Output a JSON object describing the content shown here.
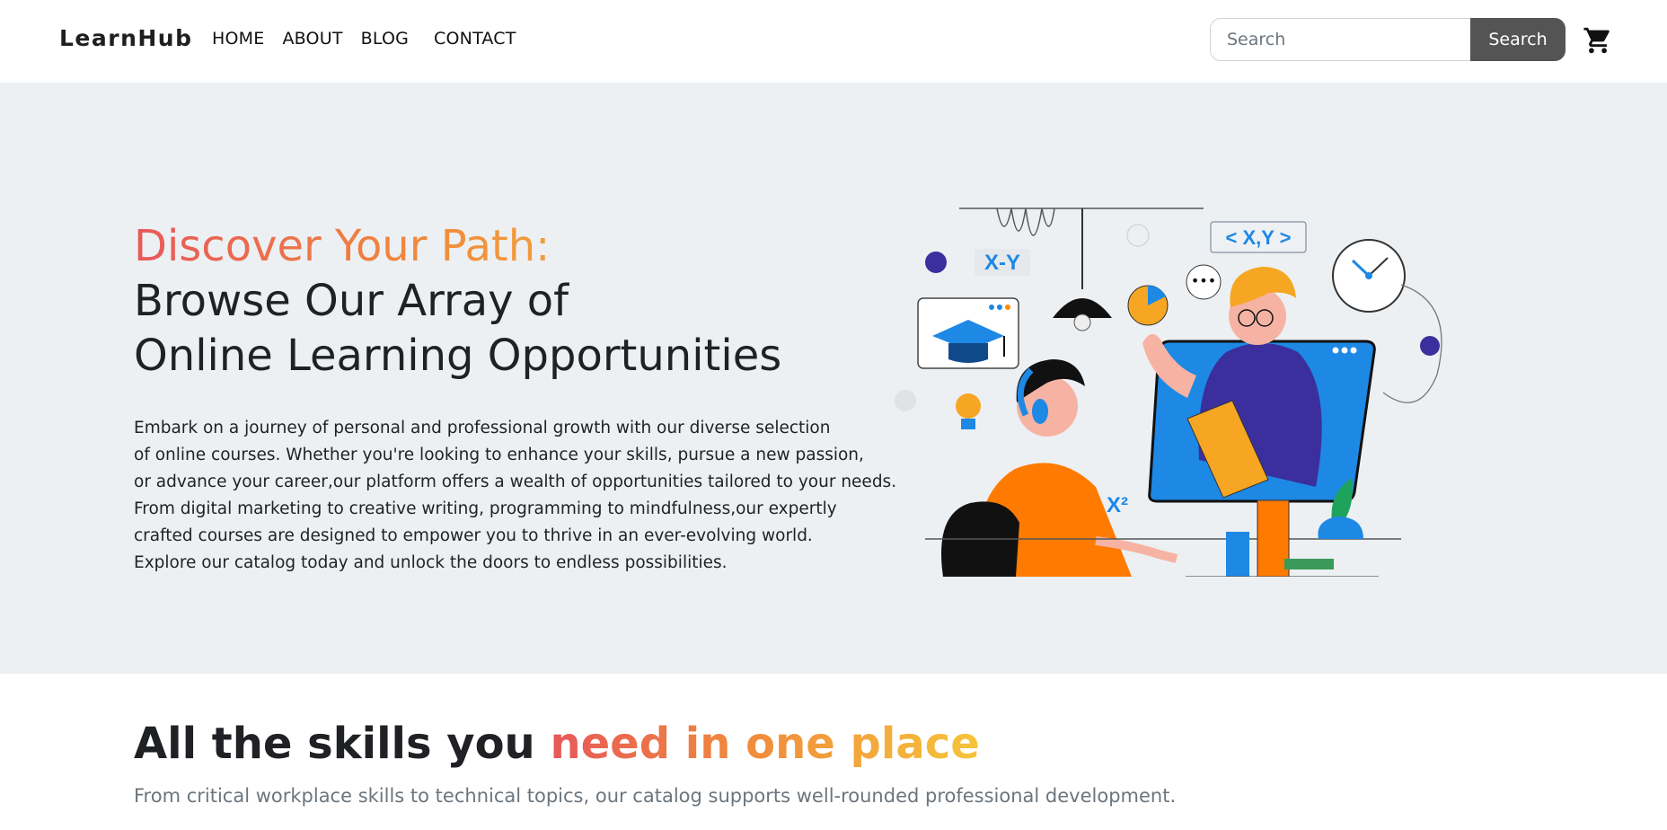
{
  "navbar": {
    "brand": "LearnHub",
    "links": [
      "HOME",
      "ABOUT",
      "BLOG",
      "CONTACT"
    ],
    "search_placeholder": "Search",
    "search_button": "Search",
    "cart_icon": "cart-icon"
  },
  "hero": {
    "title_highlight": "Discover Your Path:",
    "title_line2": "Browse Our Array of",
    "title_line3": "Online Learning Opportunities",
    "description_lines": [
      "Embark on a journey of personal and professional growth with our diverse selection",
      "of online courses. Whether you're looking to enhance your skills, pursue a new passion,",
      "or advance your career,our platform offers a wealth of opportunities tailored to your needs.",
      "From digital marketing to creative writing, programming to mindfulness,our expertly",
      "crafted courses are designed to empower you to thrive in an ever-evolving world.",
      "Explore our catalog today and unlock the doors to endless possibilities."
    ],
    "illustration_labels": {
      "formula1": "X-Y",
      "formula2": "< X,Y >",
      "formula3": "X²"
    }
  },
  "skills": {
    "title_prefix": "All the skills you ",
    "title_highlight": "need in one place",
    "subtitle": "From critical workplace skills to technical topics, our catalog supports well-rounded professional development."
  },
  "colors": {
    "accent_gradient_start": "#e8585a",
    "accent_gradient_end": "#f6c43a",
    "hero_bg": "#edf0f3",
    "search_button_bg": "#545454"
  }
}
